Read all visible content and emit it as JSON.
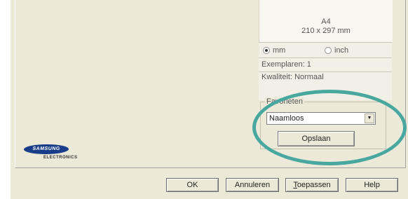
{
  "preview": {
    "paper_name": "A4",
    "paper_size": "210 x 297 mm",
    "units": [
      {
        "label": "mm",
        "selected": true
      },
      {
        "label": "inch",
        "selected": false
      }
    ],
    "copies": "Exemplaren: 1",
    "quality": "Kwaliteit: Normaal"
  },
  "favorites": {
    "legend": "Favorieten",
    "selected": "Naamloos",
    "save_label": "Opslaan"
  },
  "logo": {
    "brand": "SAMSUNG",
    "sub": "ELECTRONICS"
  },
  "buttons": {
    "ok": "OK",
    "cancel": "Annuleren",
    "apply_prefix": "T",
    "apply_rest": "oepassen",
    "help": "Help"
  },
  "colors": {
    "highlight": "#48a8a0",
    "logo_blue": "#1a3d8a"
  }
}
